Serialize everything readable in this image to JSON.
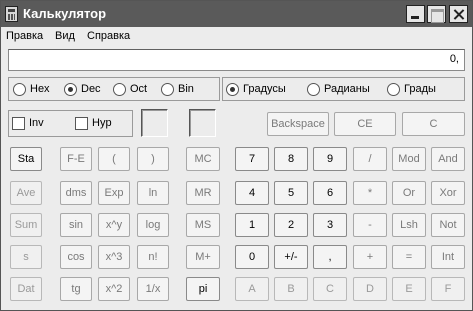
{
  "window": {
    "title": "Калькулятор"
  },
  "menu": [
    "Правка",
    "Вид",
    "Справка"
  ],
  "display": {
    "value": "0,"
  },
  "radix": [
    {
      "label": "Hex",
      "checked": false
    },
    {
      "label": "Dec",
      "checked": true
    },
    {
      "label": "Oct",
      "checked": false
    },
    {
      "label": "Bin",
      "checked": false
    }
  ],
  "angle": [
    {
      "label": "Градусы",
      "checked": true
    },
    {
      "label": "Радианы",
      "checked": false
    },
    {
      "label": "Грады",
      "checked": false
    }
  ],
  "checks": [
    {
      "label": "Inv",
      "checked": false
    },
    {
      "label": "Hyp",
      "checked": false
    }
  ],
  "top_buttons": [
    "Backspace",
    "CE",
    "C"
  ],
  "sci_col1": [
    "Sta",
    "Ave",
    "Sum",
    "s",
    "Dat"
  ],
  "sci_grid": [
    [
      "F-E",
      "(",
      ")"
    ],
    [
      "dms",
      "Exp",
      "ln"
    ],
    [
      "sin",
      "x^y",
      "log"
    ],
    [
      "cos",
      "x^3",
      "n!"
    ],
    [
      "tg",
      "x^2",
      "1/x"
    ]
  ],
  "mem_buttons": [
    "MC",
    "MR",
    "MS",
    "M+",
    "pi"
  ],
  "main_grid": [
    [
      "7",
      "8",
      "9",
      "/",
      "Mod",
      "And"
    ],
    [
      "4",
      "5",
      "6",
      "*",
      "Or",
      "Xor"
    ],
    [
      "1",
      "2",
      "3",
      "-",
      "Lsh",
      "Not"
    ],
    [
      "0",
      "+/-",
      ",",
      "+",
      "=",
      "Int"
    ],
    [
      "A",
      "B",
      "C",
      "D",
      "E",
      "F"
    ]
  ],
  "colors": {
    "titlebar": "#5a5a5a",
    "window_bg": "#ececec",
    "button_bg": "#f4f4f4"
  }
}
